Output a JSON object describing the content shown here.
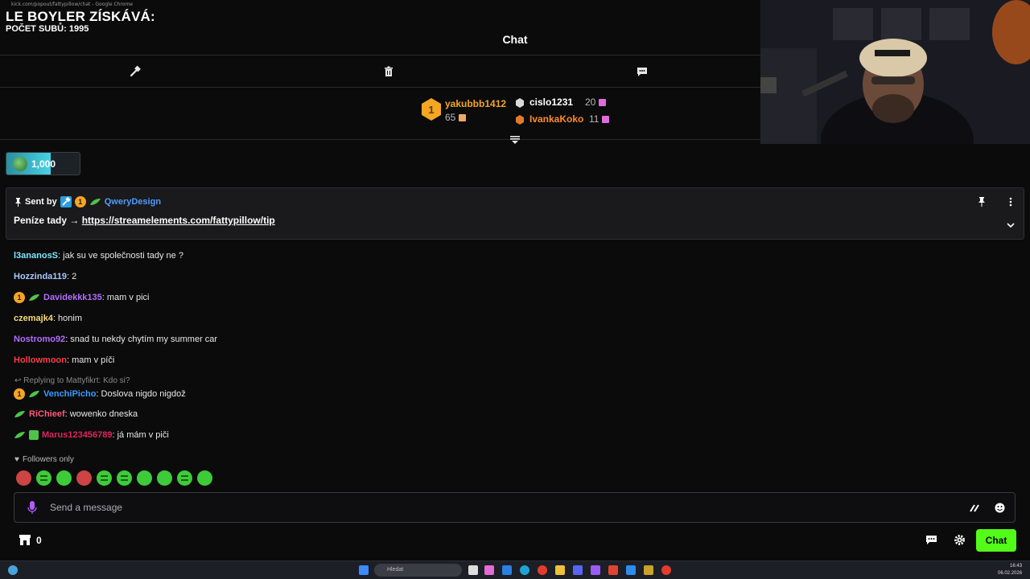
{
  "browser": {
    "title": "kick.com/popout/fattypillow/chat - Google Chrome"
  },
  "overlay": {
    "title": "LE BOYLER ZÍSKÁVÁ:",
    "subtitle": "POČET SUBŮ: 1995"
  },
  "header": {
    "title": "Chat"
  },
  "toolbar": {
    "icons": [
      "hammer-icon",
      "trash-icon",
      "chat-bubble-icon"
    ]
  },
  "leaderboard": {
    "first": {
      "rank": "1",
      "name": "yakubbb1412",
      "count": "65"
    },
    "second": {
      "name": "cislo1231",
      "count": "20"
    },
    "third": {
      "name": "IvankaKoko",
      "count": "11"
    }
  },
  "points": {
    "value": "1,000",
    "fill_fraction": 0.6
  },
  "pinned": {
    "sent_label": "Sent by",
    "badge_rank": "1",
    "user": "QweryDesign",
    "message_prefix": "Peníze tady → ",
    "link": "https://streamelements.com/fattypillow/tip"
  },
  "messages": [
    {
      "user": "l3ananosS",
      "color": "#7ee7ff",
      "text": ": jak su ve společnosti tady ne ?",
      "badges": []
    },
    {
      "user": "Hozzinda119",
      "color": "#a8c8ff",
      "text": ": 2",
      "badges": []
    },
    {
      "user": "Davidekkk135",
      "color": "#b46cff",
      "text": ": mam v pici",
      "badges": [
        "1",
        "leaf"
      ]
    },
    {
      "user": "czemajk4",
      "color": "#f5d97a",
      "text": ": honim",
      "badges": []
    },
    {
      "user": "Nostromo92",
      "color": "#b46cff",
      "text": ": snad tu nekdy chytím my summer car",
      "badges": []
    },
    {
      "user": "Hollowmoon",
      "color": "#ff3b4a",
      "text": ": mam v píči",
      "badges": []
    },
    {
      "user": "VenchiPicho",
      "color": "#3a9bff",
      "text": ": Doslova nigdo nigdož",
      "badges": [
        "1",
        "leaf"
      ],
      "reply": "Replying to Mattyfikrt: Kdo si?"
    },
    {
      "user": "RiChieef",
      "color": "#ff5a7a",
      "text": ": wowenko dneska",
      "badges": [
        "leaf"
      ]
    },
    {
      "user": "Marus123456789",
      "color": "#e0245e",
      "text": ": já mám v piči",
      "badges": [
        "leaf",
        "box"
      ]
    }
  ],
  "followers_only": "Followers only",
  "input": {
    "placeholder": "Send a message"
  },
  "footer": {
    "store_count": "0",
    "chat_button": "Chat"
  },
  "taskbar": {
    "search_placeholder": "Hledat",
    "time": "16:43",
    "date": "06.02.2026"
  },
  "colors": {
    "accent": "#53fc18",
    "gold": "#f5a623",
    "pinned_user": "#4a9eff"
  }
}
